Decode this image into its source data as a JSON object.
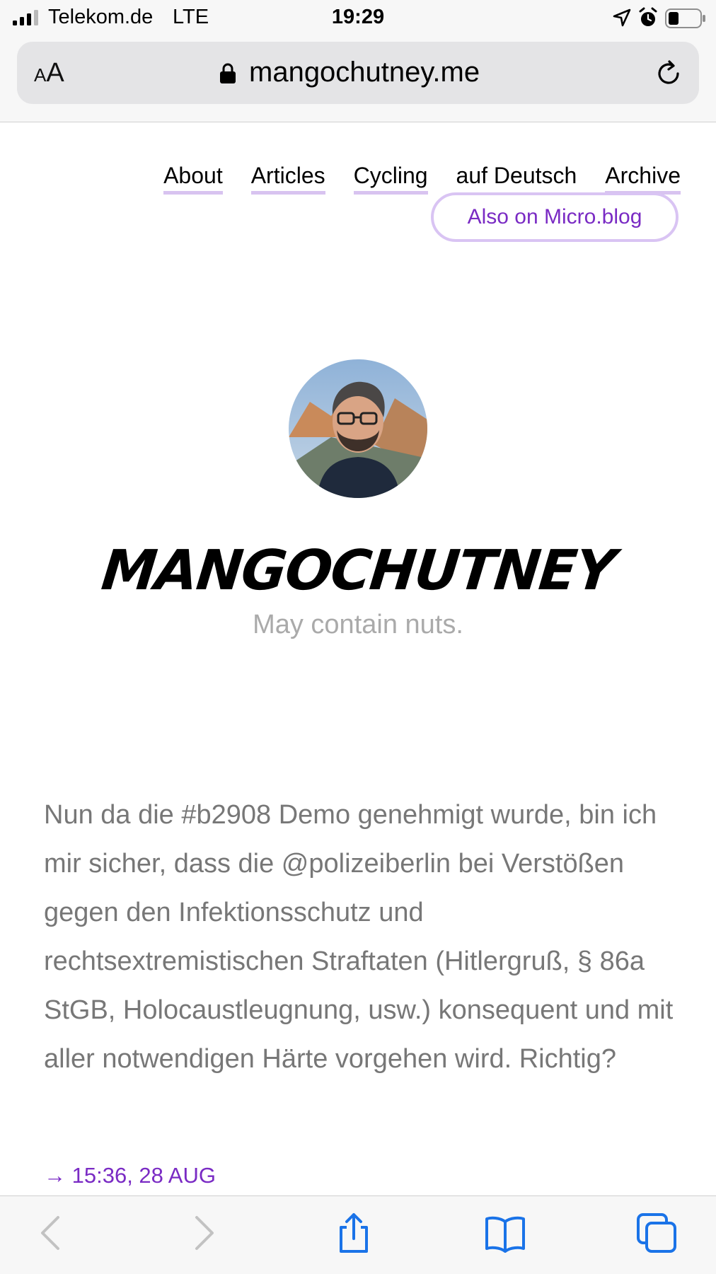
{
  "status_bar": {
    "carrier": "Telekom.de",
    "network": "LTE",
    "time": "19:29",
    "icons": [
      "signal-icon",
      "location-arrow-icon",
      "alarm-icon",
      "battery-icon"
    ]
  },
  "browser": {
    "text_size_label_small": "A",
    "text_size_label_large": "A",
    "url": "mangochutney.me",
    "icons": [
      "lock-icon",
      "reload-icon"
    ],
    "toolbar_icons": [
      "back-icon",
      "forward-icon",
      "share-icon",
      "bookmarks-icon",
      "tabs-icon"
    ]
  },
  "site": {
    "nav": {
      "items": [
        {
          "label": "About"
        },
        {
          "label": "Articles"
        },
        {
          "label": "Cycling"
        },
        {
          "label": "auf Deutsch"
        },
        {
          "label": "Archive"
        }
      ],
      "microblog_label": "Also on Micro.blog"
    },
    "title": "MANGOCHUTNEY",
    "tagline": "May contain nuts.",
    "post": {
      "text": "Nun da die #b2908 Demo genehmigt wurde, bin ich mir sicher, dass die @polizeiberlin bei Verstößen gegen den Infektionsschutz und rechtsextremistischen Straftaten (Hitlergruß, § 86a StGB, Holocaustleugnung, usw.) konsequent und mit aller notwendigen Härte vorgehen wird. Richtig?",
      "meta": "→ 15:36, 28 AUG"
    }
  },
  "colors": {
    "accent": "#7a2bc4",
    "nav_underline": "#d8c3f0",
    "body_text": "#777777",
    "tagline": "#aaaaaa",
    "ios_blue": "#1a73e8"
  }
}
